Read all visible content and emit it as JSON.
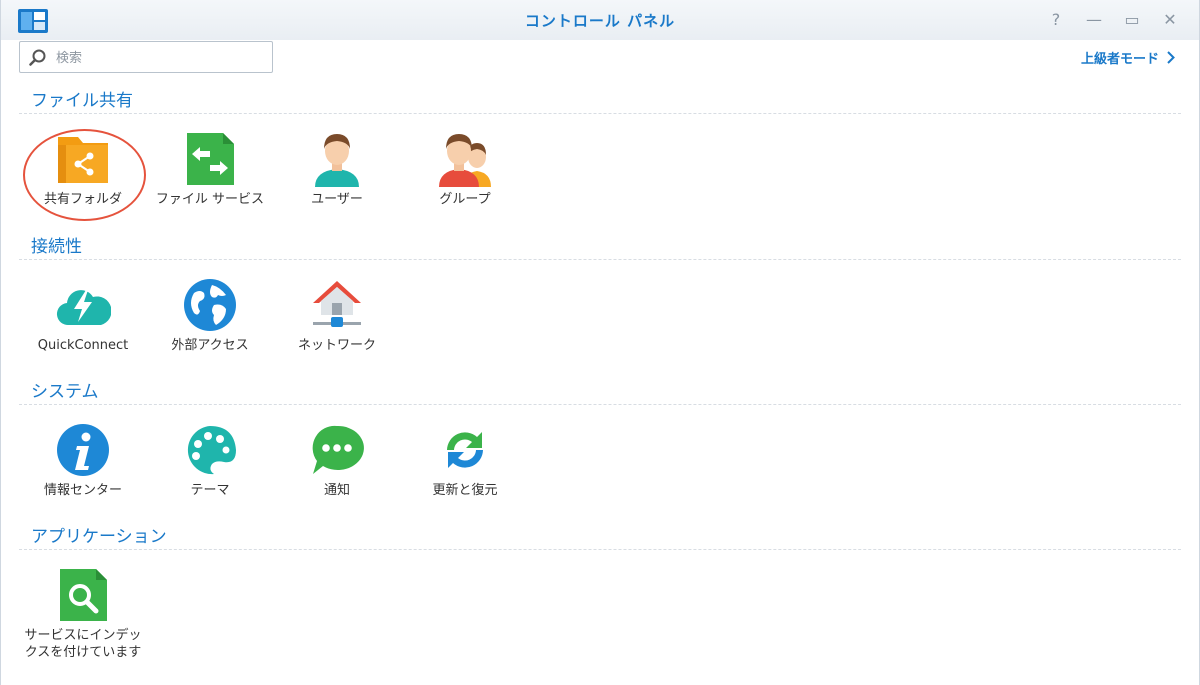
{
  "window": {
    "title": "コントロール パネル",
    "buttons": {
      "help": "?",
      "minimize": "—",
      "maximize": "▭",
      "close": "✕"
    }
  },
  "search": {
    "placeholder": "検索",
    "value": ""
  },
  "advanced_mode": {
    "label": "上級者モード"
  },
  "sections": [
    {
      "title": "ファイル共有",
      "items": [
        {
          "label": "共有フォルダ",
          "icon": "shared-folder-icon",
          "highlighted": true
        },
        {
          "label": "ファイル サービス",
          "icon": "file-services-icon"
        },
        {
          "label": "ユーザー",
          "icon": "user-icon"
        },
        {
          "label": "グループ",
          "icon": "group-icon"
        }
      ]
    },
    {
      "title": "接続性",
      "items": [
        {
          "label": "QuickConnect",
          "icon": "quickconnect-icon"
        },
        {
          "label": "外部アクセス",
          "icon": "external-access-icon"
        },
        {
          "label": "ネットワーク",
          "icon": "network-icon"
        }
      ]
    },
    {
      "title": "システム",
      "items": [
        {
          "label": "情報センター",
          "icon": "info-center-icon"
        },
        {
          "label": "テーマ",
          "icon": "theme-icon"
        },
        {
          "label": "通知",
          "icon": "notification-icon"
        },
        {
          "label": "更新と復元",
          "icon": "update-restore-icon"
        }
      ]
    },
    {
      "title": "アプリケーション",
      "items": [
        {
          "label": "サービスにインデックスを付けています",
          "icon": "indexing-service-icon"
        }
      ]
    }
  ],
  "colors": {
    "accent": "#1a79c9",
    "highlight_circle": "#e5533d",
    "folder_orange": "#f7a823",
    "green": "#3bb34a",
    "teal": "#1fb5ac",
    "blue": "#1e88d6"
  }
}
